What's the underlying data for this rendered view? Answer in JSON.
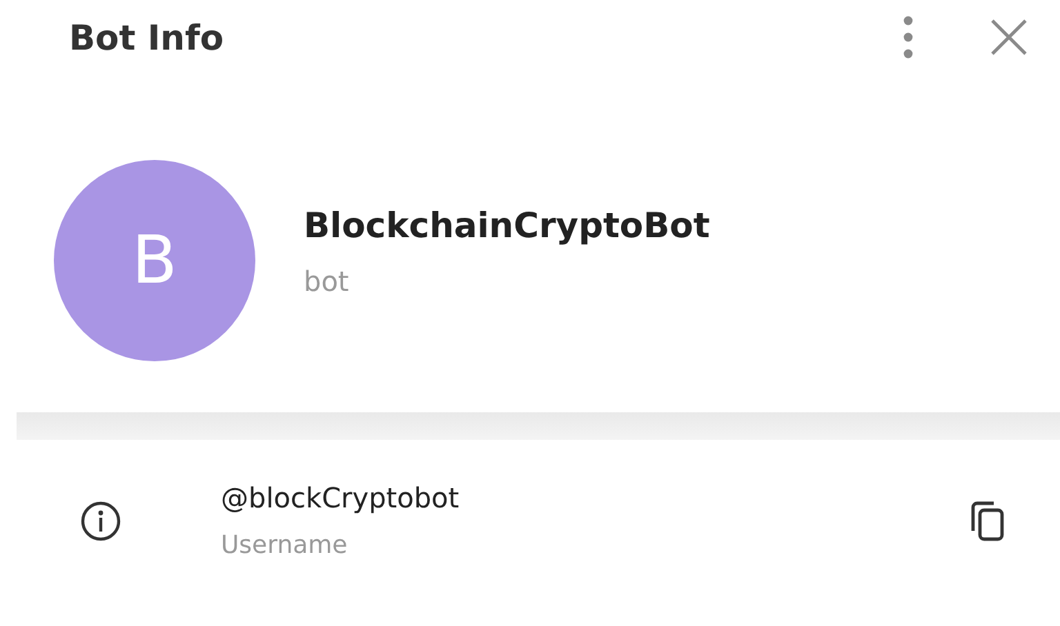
{
  "header": {
    "title": "Bot Info"
  },
  "profile": {
    "avatar_letter": "B",
    "name": "BlockchainCryptoBot",
    "status": "bot"
  },
  "info": {
    "value": "@blockCryptobot",
    "label": "Username"
  }
}
